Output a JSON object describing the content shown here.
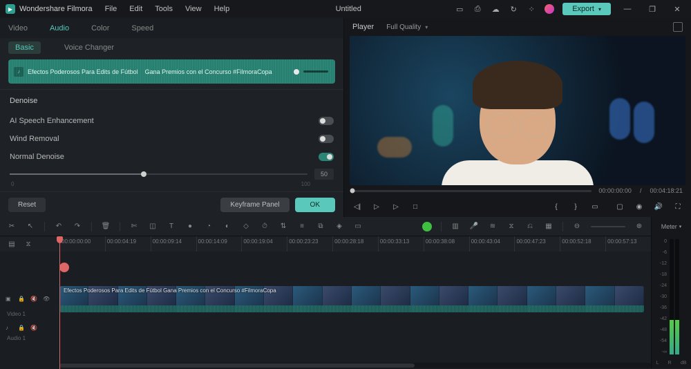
{
  "app": {
    "name": "Wondershare Filmora",
    "title": "Untitled"
  },
  "menu": [
    "File",
    "Edit",
    "Tools",
    "View",
    "Help"
  ],
  "export": "Export",
  "tabs": [
    "Video",
    "Audio",
    "Color",
    "Speed"
  ],
  "activeTab": "Audio",
  "subtabs": [
    "Basic",
    "Voice Changer"
  ],
  "activeSubtab": "Basic",
  "wave": {
    "text1": "Efectos Poderosos Para Edits de Fútbol",
    "text2": "Gana Premios con el Concurso #FilmoraCopa"
  },
  "denoise": {
    "header": "Denoise",
    "opts": [
      {
        "label": "AI Speech Enhancement",
        "on": false
      },
      {
        "label": "Wind Removal",
        "on": false
      },
      {
        "label": "Normal Denoise",
        "on": true
      }
    ],
    "slider": {
      "value": "50",
      "min": "0",
      "max": "100"
    }
  },
  "footer": {
    "reset": "Reset",
    "keyframe": "Keyframe Panel",
    "ok": "OK"
  },
  "player": {
    "label": "Player",
    "quality": "Full Quality",
    "cur": "00:00:00:00",
    "dur": "00:04:18:21",
    "sep": "/"
  },
  "timeline": {
    "ticks": [
      "00:00:00:00",
      "00:00:04:19",
      "00:00:09:14",
      "00:00:14:09",
      "00:00:19:04",
      "00:00:23:23",
      "00:00:28:18",
      "00:00:33:13",
      "00:00:38:08",
      "00:00:43:04",
      "00:00:47:23",
      "00:00:52:18",
      "00:00:57:13"
    ],
    "videoTrack": "Video 1",
    "audioTrack": "Audio 1",
    "clipLabel": "Efectos Poderosos Para Edits de Fútbol   Gana Premios con el Concurso #FilmoraCopa"
  },
  "meters": {
    "label": "Meter",
    "scale": [
      "0",
      "-6",
      "-12",
      "-18",
      "-24",
      "-30",
      "-36",
      "-42",
      "-48",
      "-54",
      "-∞"
    ],
    "L": "L",
    "R": "R",
    "dB": "dB"
  }
}
